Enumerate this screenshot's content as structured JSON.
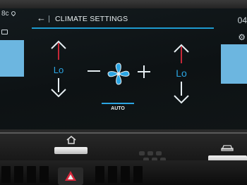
{
  "status": {
    "temp_text": "8c",
    "clock": "04"
  },
  "header": {
    "back_glyph": "←",
    "title": "CLIMATE SETTINGS"
  },
  "climate": {
    "left_temp": "Lo",
    "right_temp": "Lo",
    "fan_mode": "AUTO"
  },
  "colors": {
    "accent": "#2ba5e3",
    "screen_bg": "#0f1416",
    "text": "#e8eef0",
    "side_panel": "#6cb6e0"
  },
  "icons": [
    "location-pin-icon",
    "back-arrow-icon",
    "fan-icon",
    "home-icon",
    "car-icon",
    "wrench-icon"
  ]
}
